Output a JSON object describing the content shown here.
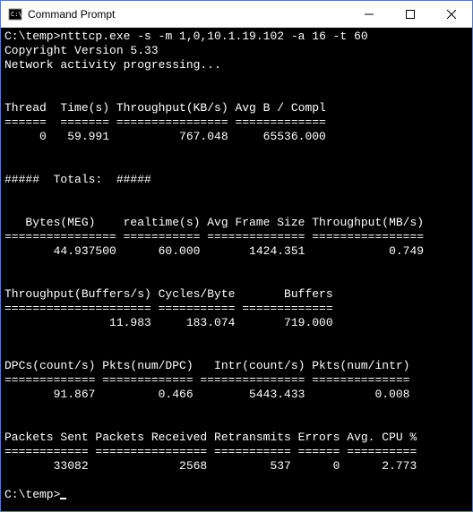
{
  "window": {
    "title": "Command Prompt"
  },
  "cmd": {
    "prompt1": "C:\\temp>",
    "command": "ntttcp.exe -s -m 1,0,10.1.19.102 -a 16 -t 60",
    "copyright": "Copyright Version 5.33",
    "progress": "Network activity progressing...",
    "thread_header": "Thread  Time(s) Throughput(KB/s) Avg B / Compl",
    "thread_rule": "======  ======= ================ =============",
    "thread_row": "     0   59.991          767.048     65536.000",
    "totals_header": "#####  Totals:  #####",
    "totals1_header": "   Bytes(MEG)    realtime(s) Avg Frame Size Throughput(MB/s)",
    "totals1_rule": "================ =========== ============== ================",
    "totals1_row": "       44.937500      60.000       1424.351            0.749",
    "totals2_header": "Throughput(Buffers/s) Cycles/Byte       Buffers",
    "totals2_rule": "===================== =========== =============",
    "totals2_row": "               11.983     183.074       719.000",
    "totals3_header": "DPCs(count/s) Pkts(num/DPC)   Intr(count/s) Pkts(num/intr)",
    "totals3_rule": "============= ============= =============== ==============",
    "totals3_row": "       91.867         0.466        5443.433          0.008",
    "totals4_header": "Packets Sent Packets Received Retransmits Errors Avg. CPU %",
    "totals4_rule": "============ ================ =========== ====== ==========",
    "totals4_row": "       33082             2568         537      0      2.773",
    "prompt2": "C:\\temp>"
  },
  "chart_data": {
    "type": "table",
    "title": "NTttcp network throughput test output",
    "command": "ntttcp.exe -s -m 1,0,10.1.19.102 -a 16 -t 60",
    "thread_stats": {
      "columns": [
        "Thread",
        "Time(s)",
        "Throughput(KB/s)",
        "Avg B / Compl"
      ],
      "rows": [
        [
          0,
          59.991,
          767.048,
          65536.0
        ]
      ]
    },
    "totals": {
      "Bytes(MEG)": 44.9375,
      "realtime(s)": 60.0,
      "Avg Frame Size": 1424.351,
      "Throughput(MB/s)": 0.749,
      "Throughput(Buffers/s)": 11.983,
      "Cycles/Byte": 183.074,
      "Buffers": 719.0,
      "DPCs(count/s)": 91.867,
      "Pkts(num/DPC)": 0.466,
      "Intr(count/s)": 5443.433,
      "Pkts(num/intr)": 0.008,
      "Packets Sent": 33082,
      "Packets Received": 2568,
      "Retransmits": 537,
      "Errors": 0,
      "Avg. CPU %": 2.773
    }
  }
}
